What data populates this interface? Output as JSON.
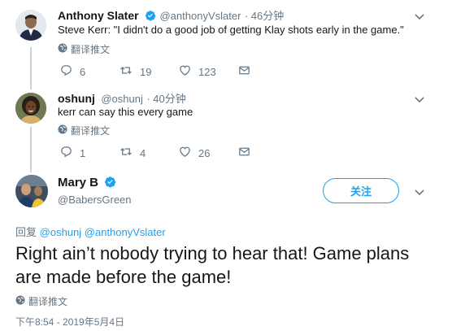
{
  "tweet1": {
    "name": "Anthony Slater",
    "handle": "@anthonyVslater",
    "time": "· 46分钟",
    "text": "Steve Kerr: \"I didn't do a good job of getting Klay shots early in the game.\"",
    "translate": "翻译推文",
    "reply_count": "6",
    "retweet_count": "19",
    "like_count": "123"
  },
  "tweet2": {
    "name": "oshunj",
    "handle": "@oshunj",
    "time": "· 40分钟",
    "text": "kerr can say this every game",
    "translate": "翻译推文",
    "reply_count": "1",
    "retweet_count": "4",
    "like_count": "26"
  },
  "main": {
    "name": "Mary B",
    "handle": "@BabersGreen",
    "follow_label": "关注",
    "reply_prefix": "回复",
    "reply_to_1": "@oshunj",
    "reply_to_2": "@anthonyVslater",
    "text": "Right ain’t nobody trying to hear  that! Game plans are made before the game!",
    "translate": "翻译推文",
    "timestamp": "下午8:54 - 2019年5月4日"
  },
  "colors": {
    "accent": "#1da1f2",
    "muted": "#657786",
    "thread": "#c9d3dc"
  }
}
